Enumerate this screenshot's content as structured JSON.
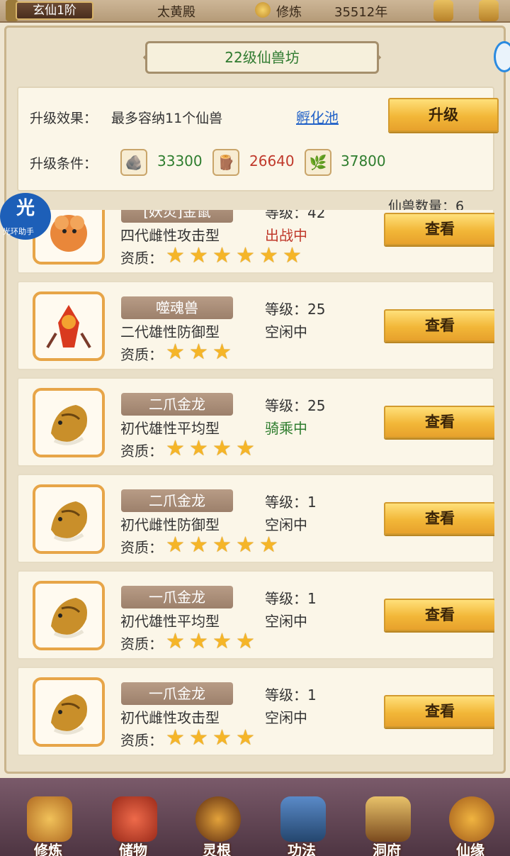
{
  "topbar": {
    "rank": "玄仙1阶",
    "location": "太黄殿",
    "cultivate_label": "修炼",
    "cultivate_years": "35512年"
  },
  "title": "22级仙兽坊",
  "upgrade": {
    "effect_label": "升级效果：",
    "effect_text": "最多容纳11个仙兽",
    "hatch_link": "孵化池",
    "button": "升级",
    "condition_label": "升级条件：",
    "resources": [
      {
        "icon": "stone-icon",
        "value": "33300",
        "color": "#2e7d2e"
      },
      {
        "icon": "wood-icon",
        "value": "26640",
        "color": "#c0392b"
      },
      {
        "icon": "herb-icon",
        "value": "37800",
        "color": "#2e7d2e"
      }
    ]
  },
  "beast_count": "仙兽数量：6",
  "beasts": [
    {
      "name": "[妖灵]金鼠",
      "level": "等级：42",
      "desc": "四代雌性攻击型",
      "status": "出战中",
      "status_color": "#c0392b",
      "stars": 6,
      "portrait": "golden-rat-icon",
      "view": "查看",
      "quality": "资质："
    },
    {
      "name": "噬魂兽",
      "level": "等级：25",
      "desc": "二代雄性防御型",
      "status": "空闲中",
      "status_color": "#333333",
      "stars": 3,
      "portrait": "soul-beast-icon",
      "view": "查看",
      "quality": "资质："
    },
    {
      "name": "二爪金龙",
      "level": "等级：25",
      "desc": "初代雄性平均型",
      "status": "骑乘中",
      "status_color": "#2e7d2e",
      "stars": 4,
      "portrait": "golden-dragon-icon",
      "view": "查看",
      "quality": "资质："
    },
    {
      "name": "二爪金龙",
      "level": "等级：1",
      "desc": "初代雌性防御型",
      "status": "空闲中",
      "status_color": "#333333",
      "stars": 5,
      "portrait": "golden-dragon-icon",
      "view": "查看",
      "quality": "资质："
    },
    {
      "name": "一爪金龙",
      "level": "等级：1",
      "desc": "初代雄性平均型",
      "status": "空闲中",
      "status_color": "#333333",
      "stars": 4,
      "portrait": "golden-dragon-icon",
      "view": "查看",
      "quality": "资质："
    },
    {
      "name": "一爪金龙",
      "level": "等级：1",
      "desc": "初代雌性攻击型",
      "status": "空闲中",
      "status_color": "#333333",
      "stars": 4,
      "portrait": "golden-dragon-icon",
      "view": "查看",
      "quality": "资质："
    }
  ],
  "nav": [
    {
      "label": "修炼",
      "icon": "monk-icon"
    },
    {
      "label": "储物",
      "icon": "bag-icon"
    },
    {
      "label": "灵根",
      "icon": "spirit-root-icon"
    },
    {
      "label": "功法",
      "icon": "book-icon"
    },
    {
      "label": "洞府",
      "icon": "palace-icon"
    },
    {
      "label": "仙缘",
      "icon": "gourd-icon"
    }
  ],
  "watermark": {
    "main": "光",
    "sub": "光环助手"
  }
}
